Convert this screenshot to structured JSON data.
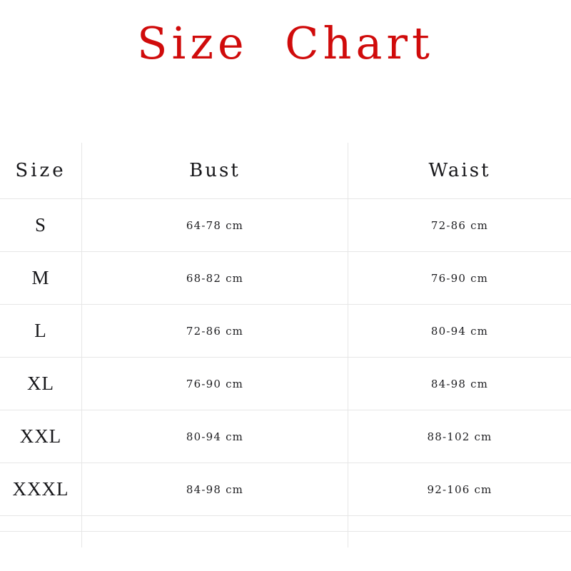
{
  "title": "Size  Chart",
  "title_color": "#d00b0b",
  "grid_color": "#e6e6e6",
  "table": {
    "columns": [
      {
        "key": "size",
        "label": "Size"
      },
      {
        "key": "bust",
        "label": "Bust"
      },
      {
        "key": "waist",
        "label": "Waist"
      }
    ],
    "rows": [
      {
        "size": "S",
        "bust": "64-78 cm",
        "waist": "72-86 cm"
      },
      {
        "size": "M",
        "bust": "68-82 cm",
        "waist": "76-90 cm"
      },
      {
        "size": "L",
        "bust": "72-86 cm",
        "waist": "80-94 cm"
      },
      {
        "size": "XL",
        "bust": "76-90 cm",
        "waist": "84-98 cm"
      },
      {
        "size": "XXL",
        "bust": "80-94 cm",
        "waist": "88-102 cm"
      },
      {
        "size": "XXXL",
        "bust": "84-98 cm",
        "waist": "92-106 cm"
      }
    ],
    "trailing_empty_rows": 2
  },
  "chart_data": {
    "type": "table",
    "title": "Size Chart",
    "columns": [
      "Size",
      "Bust",
      "Waist"
    ],
    "units": "cm",
    "rows": [
      [
        "S",
        "64-78 cm",
        "72-86 cm"
      ],
      [
        "M",
        "68-82 cm",
        "76-90 cm"
      ],
      [
        "L",
        "72-86 cm",
        "80-94 cm"
      ],
      [
        "XL",
        "76-90 cm",
        "84-98 cm"
      ],
      [
        "XXL",
        "80-94 cm",
        "88-102 cm"
      ],
      [
        "XXXL",
        "84-98 cm",
        "92-106 cm"
      ]
    ],
    "bust_min": [
      64,
      68,
      72,
      76,
      80,
      84
    ],
    "bust_max": [
      78,
      82,
      86,
      90,
      94,
      98
    ],
    "waist_min": [
      72,
      76,
      80,
      84,
      88,
      92
    ],
    "waist_max": [
      86,
      90,
      94,
      98,
      102,
      106
    ]
  }
}
